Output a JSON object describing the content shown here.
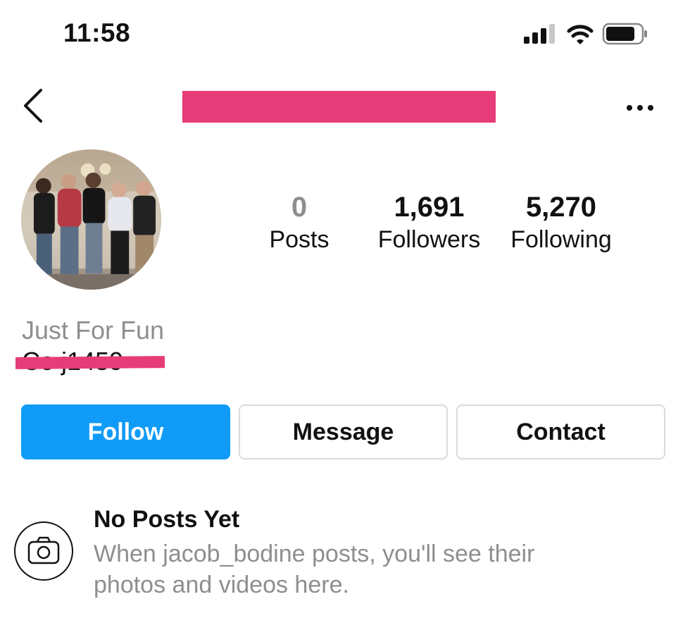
{
  "status_bar": {
    "time": "11:58",
    "icons": [
      "cellular-signal-icon",
      "wifi-icon",
      "battery-icon"
    ]
  },
  "header": {
    "back_icon": "chevron-left-icon",
    "more_icon": "more-dots-icon",
    "redaction_color": "#e63c78"
  },
  "profile": {
    "avatar": "group-photo",
    "stats": [
      {
        "value": "0",
        "label": "Posts"
      },
      {
        "value": "1,691",
        "label": "Followers"
      },
      {
        "value": "5,270",
        "label": "Following"
      }
    ],
    "bio_name": "Just For Fun",
    "bio_line": "Co  j1459"
  },
  "actions": {
    "follow": "Follow",
    "message": "Message",
    "contact": "Contact",
    "follow_color": "#0f9bf7"
  },
  "empty_state": {
    "icon": "camera-icon",
    "title": "No Posts Yet",
    "message_line1": "When jacob_bodine posts, you'll see their",
    "message_line2": "photos and videos here."
  }
}
